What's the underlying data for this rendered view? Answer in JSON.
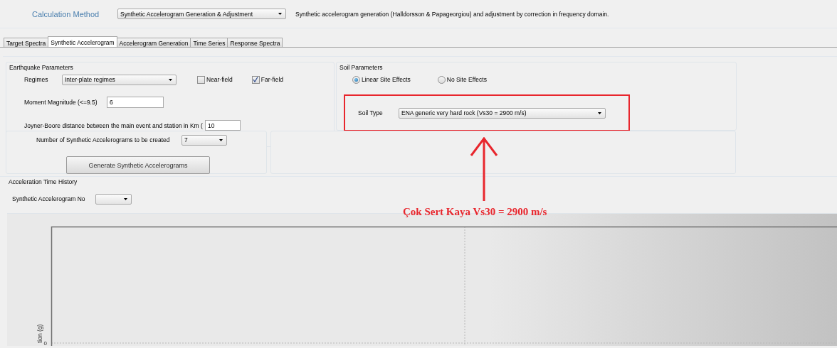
{
  "header": {
    "title": "Calculation Method",
    "method": "Synthetic Accelerogram Generation & Adjustment",
    "description": "Synthetic accelerogram generation (Halldorsson & Papageorgiou) and adjustment by correction in frequency domain."
  },
  "tabs": [
    {
      "label": "Target Spectra",
      "selected": false
    },
    {
      "label": "Synthetic Accelerogram",
      "selected": true
    },
    {
      "label": "Accelerogram Generation",
      "selected": false
    },
    {
      "label": "Time Series",
      "selected": false
    },
    {
      "label": "Response Spectra",
      "selected": false
    }
  ],
  "earthquake_parameters": {
    "title": "Earthquake Parameters",
    "regimes_label": "Regimes",
    "regime": "Inter-plate regimes",
    "checks": [
      {
        "label": "Near-field",
        "checked": false
      },
      {
        "label": "Far-field",
        "checked": true
      }
    ],
    "magnitude_label": "Moment Magnitude (<=9.5)",
    "magnitude": "6",
    "distance_label": "Joyner-Boore distance between the main event and station in Km (",
    "distance": "10"
  },
  "soil_parameters": {
    "title": "Soil Parameters",
    "radios": [
      {
        "label": "Linear Site Effects",
        "selected": true
      },
      {
        "label": "No Site Effects",
        "selected": false
      }
    ],
    "soil_type_label": "Soil Type",
    "soil_type": "ENA generic very hard rock (Vs30 = 2900 m/s)"
  },
  "generation": {
    "count_label": "Number of Synthetic Accelerograms to be created",
    "count": "7",
    "button": "Generate Synthetic Accelerograms"
  },
  "time_history": {
    "title": "Acceleration Time History",
    "number_label": "Synthetic Accelerogram No",
    "y_axis_label": "tion (g)",
    "y_tick": "0"
  },
  "annotation": {
    "highlight_soil_type": true,
    "caption": "Çok Sert Kaya Vs30 = 2900 m/s"
  }
}
